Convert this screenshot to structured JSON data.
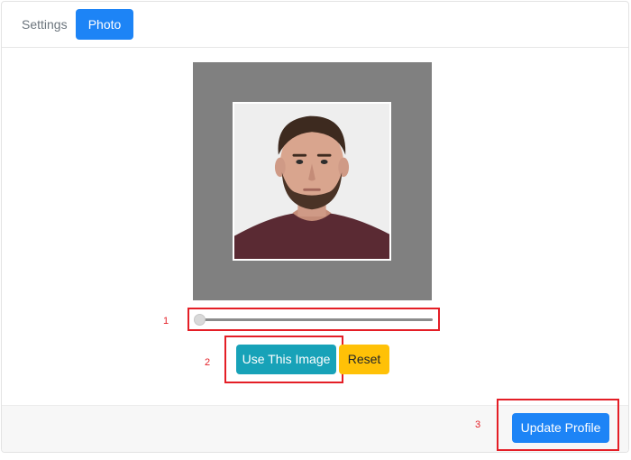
{
  "tabs": [
    {
      "label": "Settings",
      "active": false
    },
    {
      "label": "Photo",
      "active": true
    }
  ],
  "cropper": {
    "image": "portrait-photo",
    "zoom_slider": {
      "value": 0
    }
  },
  "annotations": {
    "marker_1": "1",
    "marker_2": "2",
    "marker_3": "3"
  },
  "buttons": {
    "use_image": "Use This Image",
    "reset": "Reset",
    "update_profile": "Update Profile"
  },
  "colors": {
    "primary": "#1d84f6",
    "info": "#17a2b8",
    "warning": "#ffc107",
    "annotation": "#e41e26"
  }
}
